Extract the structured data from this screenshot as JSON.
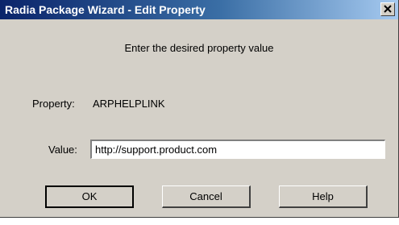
{
  "window": {
    "title": "Radia Package Wizard - Edit Property",
    "close_icon": "close-icon"
  },
  "dialog": {
    "prompt": "Enter the desired property value",
    "property_label": "Property:",
    "property_value": "ARPHELPLINK",
    "value_label": "Value:",
    "value_input": "http://support.product.com"
  },
  "buttons": {
    "ok": "OK",
    "cancel": "Cancel",
    "help": "Help"
  },
  "colors": {
    "titlebar_start": "#0a246a",
    "titlebar_end": "#a6caf0",
    "face": "#d4d0c8"
  }
}
